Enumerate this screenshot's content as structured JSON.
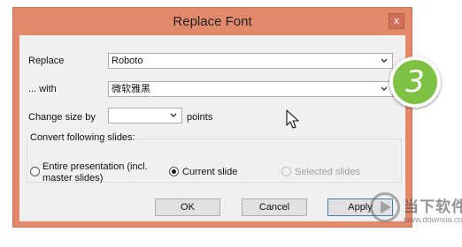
{
  "window": {
    "title": "Replace Font",
    "close_glyph": "x"
  },
  "form": {
    "replace_label": "Replace",
    "replace_value": "Roboto",
    "with_label": "... with",
    "with_value": "微软雅黑",
    "size_label": "Change size by",
    "size_value": "",
    "size_unit": "points"
  },
  "slides_group": {
    "title": "Convert following slides:",
    "options": [
      {
        "label_line1": "Entire presentation (incl.",
        "label_line2": "master slides)",
        "selected": false,
        "enabled": true
      },
      {
        "label": "Current slide",
        "selected": true,
        "enabled": true
      },
      {
        "label": "Selected slides",
        "selected": false,
        "enabled": false
      }
    ]
  },
  "buttons": {
    "ok": "OK",
    "cancel": "Cancel",
    "apply": "Apply"
  },
  "step_badge": {
    "number": "3",
    "color": "#7dc242"
  },
  "watermark": {
    "text": "当下软件园",
    "url": "www.downxia.com"
  },
  "icons": {
    "dropdown": "chevron-down-icon",
    "close": "close-icon",
    "cursor": "mouse-pointer-icon",
    "watermark_logo": "play-circle-icon"
  },
  "colors": {
    "title_bar": "#e2896b",
    "dialog_body": "#f0f0f0",
    "default_button_border": "#3c7fb1"
  }
}
